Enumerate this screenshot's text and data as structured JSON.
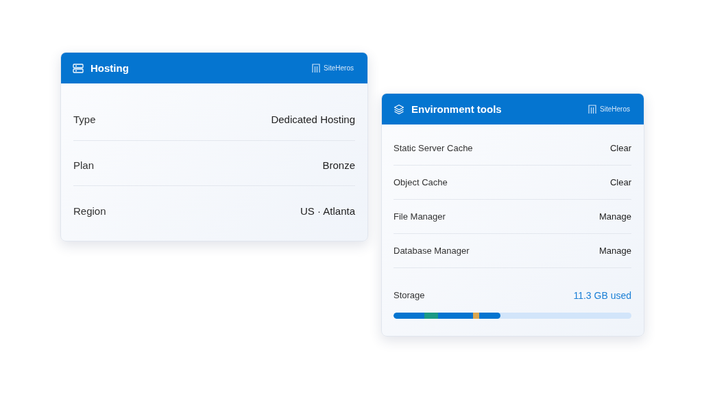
{
  "hosting": {
    "title": "Hosting",
    "brand": "SiteHeros",
    "rows": [
      {
        "label": "Type",
        "value": "Dedicated Hosting"
      },
      {
        "label": "Plan",
        "value": "Bronze"
      },
      {
        "label": "Region",
        "value": "US · Atlanta"
      }
    ]
  },
  "environment_tools": {
    "title": "Environment tools",
    "brand": "SiteHeros",
    "tools": [
      {
        "label": "Static Server Cache",
        "action": "Clear"
      },
      {
        "label": "Object Cache",
        "action": "Clear"
      },
      {
        "label": "File Manager",
        "action": "Manage"
      },
      {
        "label": "Database Manager",
        "action": "Manage"
      }
    ],
    "storage": {
      "label": "Storage",
      "reading": "11.3 GB used",
      "level": 0.451,
      "color": "#0575d0",
      "markers": [
        {
          "color": "#1a9a85"
        },
        {
          "color": "#d9a650"
        }
      ]
    }
  }
}
